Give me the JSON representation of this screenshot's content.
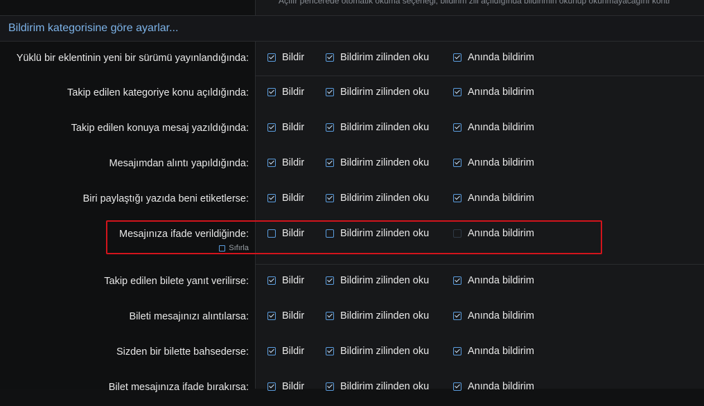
{
  "top_note": "Açılır pencerede otomatik okuma seçeneği, bildirim zili açıldığında bildirimin okunup okunmayacağını kontr",
  "section": {
    "title": "Bildirim kategorisine göre ayarlar..."
  },
  "option_labels": {
    "notify": "Bildir",
    "bell_read": "Bildirim zilinden oku",
    "instant": "Anında bildirim"
  },
  "rows": [
    {
      "label": "Yüklü bir eklentinin yeni bir sürümü yayınlandığında:",
      "notify": true,
      "bell_read": true,
      "instant": true
    },
    {
      "label": "Takip edilen kategoriye konu açıldığında:",
      "notify": true,
      "bell_read": true,
      "instant": true
    },
    {
      "label": "Takip edilen konuya mesaj yazıldığında:",
      "notify": true,
      "bell_read": true,
      "instant": true
    },
    {
      "label": "Mesajımdan alıntı yapıldığında:",
      "notify": true,
      "bell_read": true,
      "instant": true
    },
    {
      "label": "Biri paylaştığı yazıda beni etiketlerse:",
      "notify": true,
      "bell_read": true,
      "instant": true
    },
    {
      "label": "Mesajınıza ifade verildiğinde:",
      "notify": false,
      "bell_read": false,
      "instant": false,
      "instant_disabled": true,
      "reset_label": "Sıfırla"
    },
    {
      "label": "Takip edilen bilete yanıt verilirse:",
      "notify": true,
      "bell_read": true,
      "instant": true
    },
    {
      "label": "Bileti mesajınızı alıntılarsa:",
      "notify": true,
      "bell_read": true,
      "instant": true
    },
    {
      "label": "Sizden bir bilette bahsederse:",
      "notify": true,
      "bell_read": true,
      "instant": true
    },
    {
      "label": "Bilet mesajınıza ifade bırakırsa:",
      "notify": true,
      "bell_read": true,
      "instant": true
    }
  ],
  "colors": {
    "accent": "#5b9ee0",
    "section_title": "#7db3e8",
    "highlight": "#d3141c"
  }
}
